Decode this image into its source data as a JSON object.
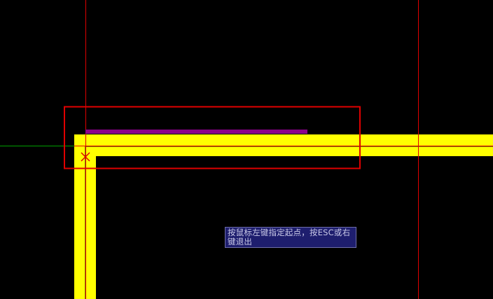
{
  "app": {
    "name": "CAD drawing canvas"
  },
  "colors": {
    "background": "#000000",
    "wall": "#FFFF00",
    "new_wall_preview": "#8B008B",
    "guide_line": "#E00000",
    "axis_green": "#00A000",
    "selection_box": "#E00000",
    "tooltip_bg": "#1E1E6E",
    "tooltip_text": "#C9C9E8"
  },
  "cursor": {
    "icon": "x-cross-cursor-icon"
  },
  "tooltip": {
    "text": "按鼠标左键指定起点，按ESC或右键退出"
  }
}
